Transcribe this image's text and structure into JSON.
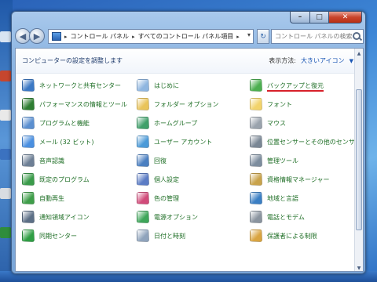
{
  "window": {
    "address_crumbs": [
      "コントロール パネル",
      "すべてのコントロール パネル項目"
    ],
    "search_placeholder": "コントロール パネルの検索",
    "caption": {
      "min": "–",
      "max": "□",
      "close": "✕"
    }
  },
  "header": {
    "title": "コンピューターの設定を調整します",
    "view_label": "表示方法:",
    "view_value": "大きいアイコン"
  },
  "items": [
    {
      "label": "ネットワークと共有センター",
      "icon": "network-icon",
      "color": "#3b78c4"
    },
    {
      "label": "はじめに",
      "icon": "getting-started-icon",
      "color": "#8fb6e0"
    },
    {
      "label": "バックアップと復元",
      "icon": "backup-icon",
      "color": "#4caf50"
    },
    {
      "label": "パフォーマンスの情報とツール",
      "icon": "performance-icon",
      "color": "#2e7d32"
    },
    {
      "label": "フォルダー オプション",
      "icon": "folder-icon",
      "color": "#e9c45a"
    },
    {
      "label": "フォント",
      "icon": "fonts-icon",
      "color": "#f2d36b"
    },
    {
      "label": "プログラムと機能",
      "icon": "programs-icon",
      "color": "#5b8fd0"
    },
    {
      "label": "ホームグループ",
      "icon": "homegroup-icon",
      "color": "#3fa06a"
    },
    {
      "label": "マウス",
      "icon": "mouse-icon",
      "color": "#9aa3ad"
    },
    {
      "label": "メール (32 ビット)",
      "icon": "mail-icon",
      "color": "#4a8fe0"
    },
    {
      "label": "ユーザー アカウント",
      "icon": "user-accounts-icon",
      "color": "#4b9ad8"
    },
    {
      "label": "位置センサーとその他のセンサー",
      "icon": "sensor-icon",
      "color": "#7a8795"
    },
    {
      "label": "音声認識",
      "icon": "speech-icon",
      "color": "#6d7f95"
    },
    {
      "label": "回復",
      "icon": "recovery-icon",
      "color": "#4a7fc1"
    },
    {
      "label": "管理ツール",
      "icon": "admin-tools-icon",
      "color": "#7d8d9e"
    },
    {
      "label": "既定のプログラム",
      "icon": "default-programs-icon",
      "color": "#3a9b4a"
    },
    {
      "label": "個人設定",
      "icon": "personalize-icon",
      "color": "#5b7cc5"
    },
    {
      "label": "資格情報マネージャー",
      "icon": "credential-icon",
      "color": "#c9a34b"
    },
    {
      "label": "自動再生",
      "icon": "autoplay-icon",
      "color": "#3f9e4a"
    },
    {
      "label": "色の管理",
      "icon": "color-management-icon",
      "color": "#d14b7a"
    },
    {
      "label": "地域と言語",
      "icon": "region-icon",
      "color": "#3b7fc4"
    },
    {
      "label": "通知領域アイコン",
      "icon": "notification-icon",
      "color": "#5c6f86"
    },
    {
      "label": "電源オプション",
      "icon": "power-icon",
      "color": "#3ea65a"
    },
    {
      "label": "電話とモデム",
      "icon": "phone-modem-icon",
      "color": "#8a949f"
    },
    {
      "label": "同期センター",
      "icon": "sync-icon",
      "color": "#2f9e44"
    },
    {
      "label": "日付と時刻",
      "icon": "datetime-icon",
      "color": "#8fa3bc"
    },
    {
      "label": "保護者による制限",
      "icon": "parental-icon",
      "color": "#d9a441"
    }
  ],
  "accent": {
    "label_green": "#1e6e25",
    "underline_red": "#d8202a",
    "link_blue": "#1c57b5"
  }
}
